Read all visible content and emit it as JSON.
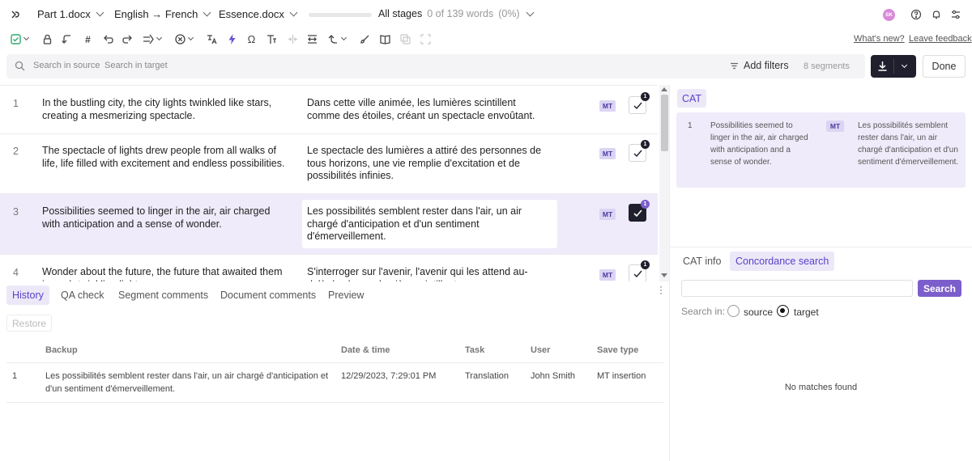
{
  "header": {
    "file_label": "Part 1.docx",
    "language_pair": "English → French",
    "project": "Essence.docx",
    "progress_fraction": 0.0,
    "stage_label": "All stages",
    "word_progress": "0 of 139 words",
    "word_percent": "(0%)",
    "user_initials": "SK"
  },
  "toolbar": {
    "whats_new": "What's new?",
    "leave_feedback": "Leave feedback"
  },
  "search": {
    "source_placeholder": "Search in source",
    "target_placeholder": "Search in target",
    "add_filters": "Add filters",
    "segment_count": "8 segments",
    "done": "Done"
  },
  "segments": [
    {
      "num": "1",
      "source": "In the bustling city, the city lights twinkled like stars, creating a mesmerizing spectacle.",
      "target": "Dans cette ville animée, les lumières scintillent comme des étoiles, créant un spectacle envoûtant.",
      "badge": "MT",
      "confirmed": false,
      "count": "1"
    },
    {
      "num": "2",
      "source": "The spectacle of lights drew people from all walks of life, life filled with excitement and endless possibilities.",
      "target": "Le spectacle des lumières a attiré des personnes de tous horizons, une vie remplie d'excitation et de possibilités infinies.",
      "badge": "MT",
      "confirmed": false,
      "count": "1"
    },
    {
      "num": "3",
      "source": "Possibilities seemed to linger in the air, air charged with anticipation and a sense of wonder.",
      "target": "Les possibilités semblent rester dans l'air, un air chargé d'anticipation et d'un sentiment d'émerveillement.",
      "badge": "MT",
      "confirmed": true,
      "count": "1"
    },
    {
      "num": "4",
      "source": "Wonder about the future, the future that awaited them in each twinkling light.",
      "target": "S'interroger sur l'avenir, l'avenir qui les attend au-delà de chaque lumière scintillante.",
      "badge": "MT",
      "confirmed": false,
      "count": "1"
    }
  ],
  "bottom_tabs": {
    "history": "History",
    "qa_check": "QA check",
    "segment_comments": "Segment comments",
    "document_comments": "Document comments",
    "preview": "Preview"
  },
  "history": {
    "restore": "Restore",
    "columns": {
      "backup": "Backup",
      "date": "Date & time",
      "task": "Task",
      "user": "User",
      "save_type": "Save type"
    },
    "rows": [
      {
        "num": "1",
        "backup": "Les possibilités semblent rester dans l'air, un air chargé d'anticipation et d'un sentiment d'émerveillement.",
        "date": "12/29/2023, 7:29:01 PM",
        "task": "Translation",
        "user": "John Smith",
        "save_type": "MT insertion"
      }
    ]
  },
  "cat_panel": {
    "tab_label": "CAT",
    "match": {
      "num": "1",
      "source": "Possibilities seemed to linger in the air, air charged with anticipation and a sense of wonder.",
      "badge": "MT",
      "target": "Les possibilités semblent rester dans l'air, un air chargé d'anticipation et d'un sentiment d'émerveillement."
    }
  },
  "concordance": {
    "tab_cat_info": "CAT info",
    "tab_concordance": "Concordance search",
    "search_button": "Search",
    "search_in_label": "Search in:",
    "option_source": "source",
    "option_target": "target",
    "selected": "target",
    "no_matches": "No matches found"
  },
  "colors": {
    "accent": "#7b5ecb",
    "dark": "#1f1f2e",
    "active_bg": "#efebfa"
  }
}
